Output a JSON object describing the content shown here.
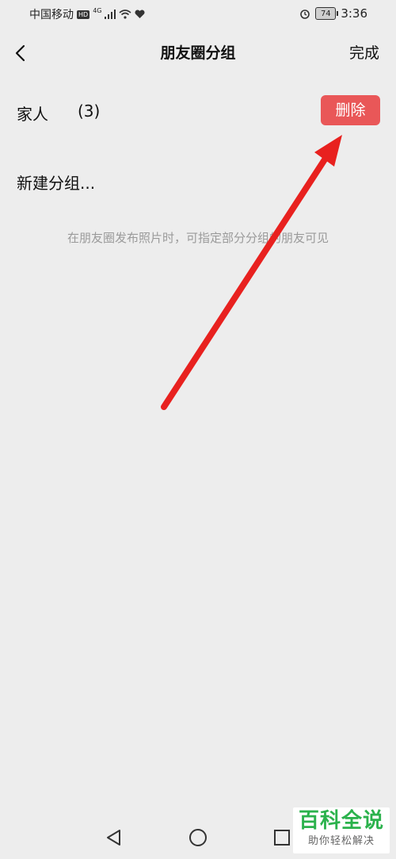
{
  "status_bar": {
    "carrier": "中国移动",
    "hd": "HD",
    "network": "4G",
    "battery": "74",
    "time": "3:36"
  },
  "nav": {
    "title": "朋友圈分组",
    "done_label": "完成"
  },
  "group": {
    "name": "家人",
    "count": "(3)",
    "delete_label": "删除"
  },
  "new_group_label": "新建分组...",
  "hint": "在朋友圈发布照片时，可指定部分分组的朋友可见",
  "colors": {
    "background": "#ededed",
    "delete_button": "#e95758",
    "annotation_arrow": "#e8211f",
    "watermark_green": "#2bb24c"
  },
  "watermark": {
    "title": "百科全说",
    "subtitle": "助你轻松解决"
  },
  "system_nav": [
    "back-icon",
    "home-icon",
    "recents-icon"
  ]
}
